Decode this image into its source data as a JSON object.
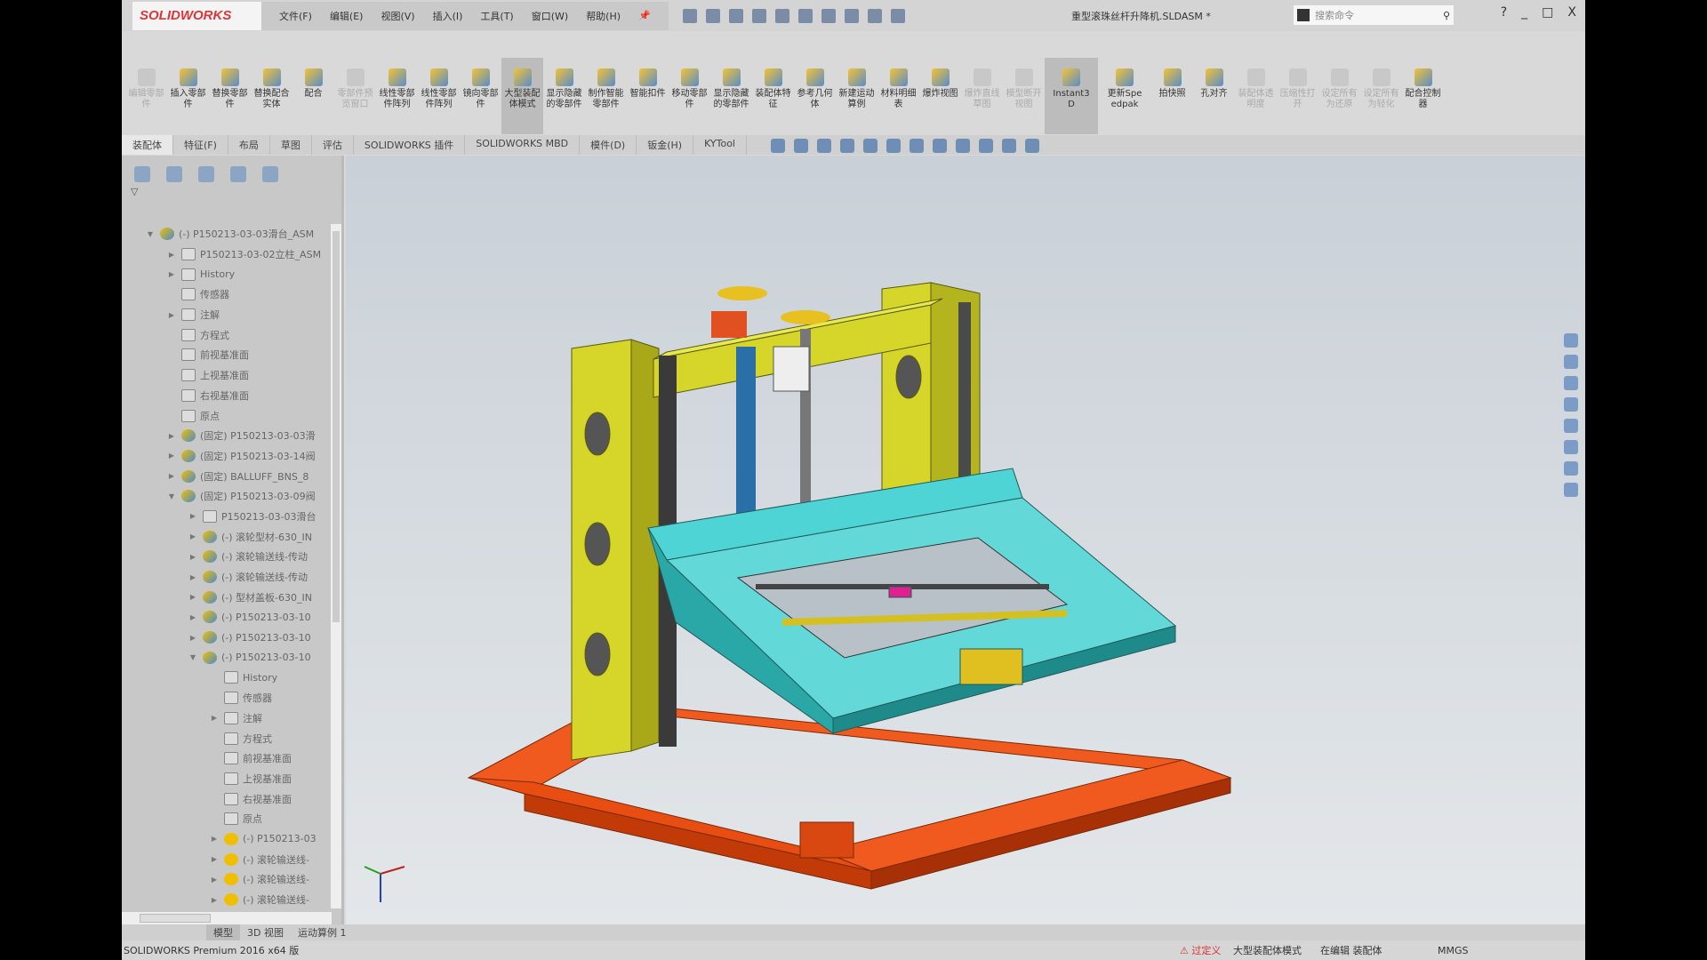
{
  "app": {
    "logo": "SOLIDWORKS",
    "document_title": "重型滚珠丝杆升降机.SLDASM *"
  },
  "menu": [
    "文件(F)",
    "编辑(E)",
    "视图(V)",
    "插入(I)",
    "工具(T)",
    "窗口(W)",
    "帮助(H)"
  ],
  "search": {
    "placeholder": "搜索命令"
  },
  "window_controls": [
    "?",
    "_",
    "□",
    "X"
  ],
  "ribbon": [
    {
      "label": "编辑零部件",
      "enabled": false
    },
    {
      "label": "插入零部件",
      "enabled": true
    },
    {
      "label": "替换零部件",
      "enabled": true
    },
    {
      "label": "替换配合实体",
      "enabled": true
    },
    {
      "label": "配合",
      "enabled": true
    },
    {
      "label": "零部件预览窗口",
      "enabled": false
    },
    {
      "label": "线性零部件阵列",
      "enabled": true
    },
    {
      "label": "线性零部件阵列",
      "enabled": true
    },
    {
      "label": "镜向零部件",
      "enabled": true
    },
    {
      "label": "大型装配体模式",
      "enabled": true,
      "active": true
    },
    {
      "label": "显示隐藏的零部件",
      "enabled": true
    },
    {
      "label": "制作智能零部件",
      "enabled": true
    },
    {
      "label": "智能扣件",
      "enabled": true
    },
    {
      "label": "移动零部件",
      "enabled": true
    },
    {
      "label": "显示隐藏的零部件",
      "enabled": true
    },
    {
      "label": "装配体特征",
      "enabled": true
    },
    {
      "label": "参考几何体",
      "enabled": true
    },
    {
      "label": "新建运动算例",
      "enabled": true
    },
    {
      "label": "材料明细表",
      "enabled": true
    },
    {
      "label": "爆炸视图",
      "enabled": true
    },
    {
      "label": "爆炸直线草图",
      "enabled": false
    },
    {
      "label": "模型断开视图",
      "enabled": false
    },
    {
      "label": "Instant3D",
      "enabled": true,
      "active": true
    },
    {
      "label": "更新Speedpak",
      "enabled": true
    },
    {
      "label": "拍快照",
      "enabled": true
    },
    {
      "label": "孔对齐",
      "enabled": true
    },
    {
      "label": "装配体透明度",
      "enabled": false
    },
    {
      "label": "压缩性打开",
      "enabled": false
    },
    {
      "label": "设定所有为还原",
      "enabled": false
    },
    {
      "label": "设定所有为轻化",
      "enabled": false
    },
    {
      "label": "配合控制器",
      "enabled": true
    }
  ],
  "tabs": [
    "装配体",
    "特征(F)",
    "布局",
    "草图",
    "评估",
    "SOLIDWORKS 插件",
    "SOLIDWORKS MBD",
    "模件(D)",
    "钣金(H)",
    "KYTool"
  ],
  "tree": [
    {
      "indent": 0,
      "tw": "▼",
      "icon": "asm",
      "label": "(-) P150213-03-03滑台_ASM"
    },
    {
      "indent": 1,
      "tw": "▶",
      "icon": "folder",
      "label": "P150213-03-02立柱_ASM"
    },
    {
      "indent": 1,
      "tw": "▶",
      "icon": "folder",
      "label": "History"
    },
    {
      "indent": 1,
      "tw": "",
      "icon": "folder",
      "label": "传感器"
    },
    {
      "indent": 1,
      "tw": "▶",
      "icon": "folder",
      "label": "注解"
    },
    {
      "indent": 1,
      "tw": "",
      "icon": "folder",
      "label": "方程式"
    },
    {
      "indent": 1,
      "tw": "",
      "icon": "plane",
      "label": "前视基准面"
    },
    {
      "indent": 1,
      "tw": "",
      "icon": "plane",
      "label": "上视基准面"
    },
    {
      "indent": 1,
      "tw": "",
      "icon": "plane",
      "label": "右视基准面"
    },
    {
      "indent": 1,
      "tw": "",
      "icon": "origin",
      "label": "原点"
    },
    {
      "indent": 1,
      "tw": "▶",
      "icon": "asm",
      "label": "(固定) P150213-03-03滑"
    },
    {
      "indent": 1,
      "tw": "▶",
      "icon": "asm",
      "label": "(固定) P150213-03-14阀"
    },
    {
      "indent": 1,
      "tw": "▶",
      "icon": "asm",
      "label": "(固定) BALLUFF_BNS_8"
    },
    {
      "indent": 1,
      "tw": "▼",
      "icon": "asm",
      "label": "(固定) P150213-03-09阀"
    },
    {
      "indent": 2,
      "tw": "▶",
      "icon": "folder",
      "label": "P150213-03-03滑台"
    },
    {
      "indent": 2,
      "tw": "▶",
      "icon": "asm",
      "label": "(-) 滚轮型材-630_IN"
    },
    {
      "indent": 2,
      "tw": "▶",
      "icon": "asm",
      "label": "(-) 滚轮输送线-传动"
    },
    {
      "indent": 2,
      "tw": "▶",
      "icon": "asm",
      "label": "(-) 滚轮输送线-传动"
    },
    {
      "indent": 2,
      "tw": "▶",
      "icon": "asm",
      "label": "(-) 型材盖板-630_IN"
    },
    {
      "indent": 2,
      "tw": "▶",
      "icon": "asm",
      "label": "(-) P150213-03-10"
    },
    {
      "indent": 2,
      "tw": "▶",
      "icon": "asm",
      "label": "(-) P150213-03-10"
    },
    {
      "indent": 2,
      "tw": "▼",
      "icon": "asm",
      "label": "(-) P150213-03-10"
    },
    {
      "indent": 3,
      "tw": "",
      "icon": "folder",
      "label": "History"
    },
    {
      "indent": 3,
      "tw": "",
      "icon": "folder",
      "label": "传感器"
    },
    {
      "indent": 3,
      "tw": "▶",
      "icon": "folder",
      "label": "注解"
    },
    {
      "indent": 3,
      "tw": "",
      "icon": "folder",
      "label": "方程式"
    },
    {
      "indent": 3,
      "tw": "",
      "icon": "plane",
      "label": "前视基准面"
    },
    {
      "indent": 3,
      "tw": "",
      "icon": "plane",
      "label": "上视基准面"
    },
    {
      "indent": 3,
      "tw": "",
      "icon": "plane",
      "label": "右视基准面"
    },
    {
      "indent": 3,
      "tw": "",
      "icon": "origin",
      "label": "原点"
    },
    {
      "indent": 3,
      "tw": "▶",
      "icon": "part",
      "label": "(-) P150213-03"
    },
    {
      "indent": 3,
      "tw": "▶",
      "icon": "part",
      "label": "(-) 滚轮输送线-"
    },
    {
      "indent": 3,
      "tw": "▶",
      "icon": "part",
      "label": "(-) 滚轮输送线-"
    },
    {
      "indent": 3,
      "tw": "▶",
      "icon": "part",
      "label": "(-) 滚轮输送线-"
    }
  ],
  "bottom_tabs": [
    "模型",
    "3D 视图",
    "运动算例 1"
  ],
  "status": {
    "product": "SOLIDWORKS Premium 2016 x64 版",
    "warning": "过定义",
    "mode": "大型装配体模式",
    "editing": "在编辑 装配体",
    "units": "MMGS"
  },
  "colors": {
    "base": "#f05a1e",
    "columns": "#d6d62a",
    "tray": "#4ed4d4",
    "accent": "#d8383a"
  }
}
